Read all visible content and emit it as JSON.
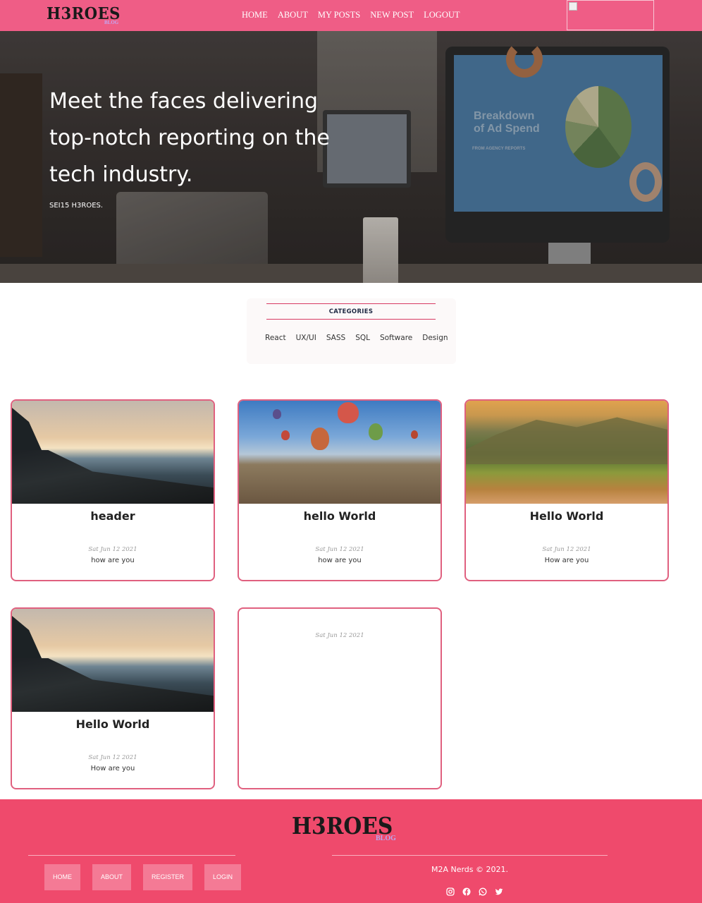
{
  "nav": {
    "logo": "H3ROES",
    "logo_sub": "BLOG",
    "links": [
      "HOME",
      "ABOUT",
      "MY POSTS",
      "NEW POST",
      "LOGOUT"
    ]
  },
  "hero": {
    "title": "Meet the faces delivering top-notch reporting on the tech industry.",
    "subtitle": "SEI15 H3ROES.",
    "image_text": "Breakdown of Ad Spend",
    "image_subtext": "FROM AGENCY REPORTS"
  },
  "categories": {
    "title": "CATEGORIES",
    "items": [
      "React",
      "UX/UI",
      "SASS",
      "SQL",
      "Software",
      "Design"
    ]
  },
  "posts": [
    {
      "title": "header",
      "date": "Sat Jun 12 2021",
      "text": "how are you",
      "image": "coast-sunset"
    },
    {
      "title": "hello World",
      "date": "Sat Jun 12 2021",
      "text": "how are you",
      "image": "hot-air-balloons"
    },
    {
      "title": "Hello World",
      "date": "Sat Jun 12 2021",
      "text": "How are you",
      "image": "green-hills"
    },
    {
      "title": "Hello World",
      "date": "Sat Jun 12 2021",
      "text": "How are you",
      "image": "coast-sunset"
    },
    {
      "title": "",
      "date": "Sat Jun 12 2021",
      "text": "",
      "image": ""
    }
  ],
  "footer": {
    "logo": "H3ROES",
    "logo_sub": "BLOG",
    "links": [
      "HOME",
      "ABOUT",
      "REGISTER",
      "LOGIN"
    ],
    "copyright": "M2A Nerds © 2021.",
    "socials": [
      "instagram-icon",
      "facebook-icon",
      "whatsapp-icon",
      "twitter-icon"
    ]
  },
  "colors": {
    "nav_bg": "#ef5d86",
    "footer_bg": "#ef4a6c",
    "card_border": "#e0607f",
    "accent_line": "#d73a62"
  }
}
